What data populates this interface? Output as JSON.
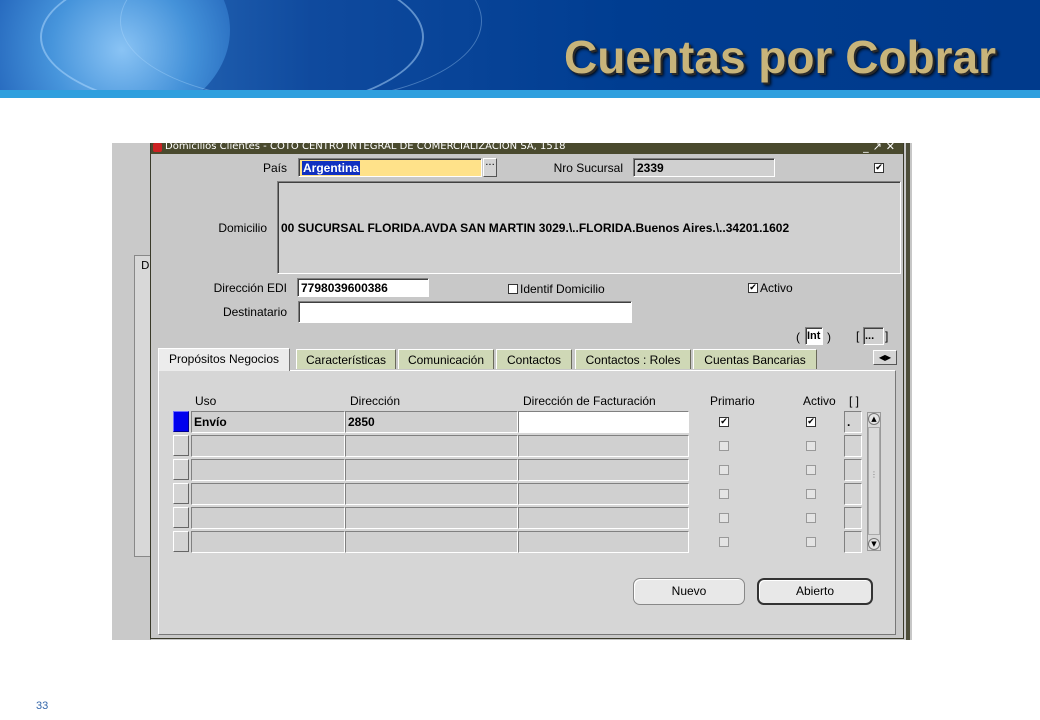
{
  "slide": {
    "title": "Cuentas por Cobrar",
    "page_number": "33"
  },
  "window": {
    "title": "Domicilios Clientes - COTO CENTRO INTEGRAL DE COMERCIALIZACION SA, 1518",
    "bg_letter": "D"
  },
  "header": {
    "pais_label": "País",
    "pais_value": "Argentina",
    "sucursal_label": "Nro Sucursal",
    "sucursal_value": "2339",
    "domicilio_label": "Domicilio",
    "domicilio_value": "00 SUCURSAL FLORIDA.AVDA SAN MARTIN 3029.\\..FLORIDA.Buenos Aires.\\..34201.1602",
    "edi_label": "Dirección EDI",
    "edi_value": "7798039600386",
    "identif_label": "Identif Domicilio",
    "activo_label": "Activo",
    "destinatario_label": "Destinatario",
    "destinatario_value": "",
    "int_label": "Int",
    "more_label": "..."
  },
  "tabs": [
    "Propósitos Negocios",
    "Características",
    "Comunicación",
    "Contactos",
    "Contactos : Roles",
    "Cuentas Bancarias"
  ],
  "grid": {
    "columns": [
      "Uso",
      "Dirección",
      "Dirección de Facturación",
      "Primario",
      "Activo",
      "[ ]"
    ],
    "rows": [
      {
        "uso": "Envío",
        "direccion": "2850",
        "facturacion": "",
        "primario": true,
        "activo": true,
        "extra": "."
      },
      {
        "uso": "",
        "direccion": "",
        "facturacion": "",
        "primario": false,
        "activo": false,
        "extra": ""
      },
      {
        "uso": "",
        "direccion": "",
        "facturacion": "",
        "primario": false,
        "activo": false,
        "extra": ""
      },
      {
        "uso": "",
        "direccion": "",
        "facturacion": "",
        "primario": false,
        "activo": false,
        "extra": ""
      },
      {
        "uso": "",
        "direccion": "",
        "facturacion": "",
        "primario": false,
        "activo": false,
        "extra": ""
      },
      {
        "uso": "",
        "direccion": "",
        "facturacion": "",
        "primario": false,
        "activo": false,
        "extra": ""
      }
    ]
  },
  "buttons": {
    "nuevo": "Nuevo",
    "abierto": "Abierto"
  }
}
